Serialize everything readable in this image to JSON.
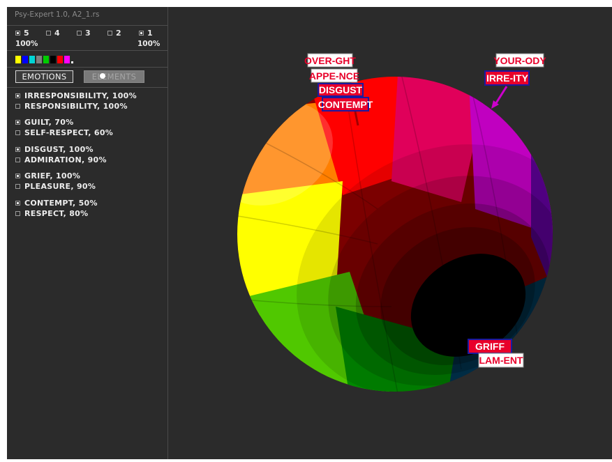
{
  "window": {
    "title": "Psy-Expert 1.0, A2_1.rs"
  },
  "levels": [
    {
      "label": "5",
      "checked": true
    },
    {
      "label": "4",
      "checked": false
    },
    {
      "label": "3",
      "checked": false
    },
    {
      "label": "2",
      "checked": false
    },
    {
      "label": "1",
      "checked": true
    }
  ],
  "percent_left": "100%",
  "percent_right": "100%",
  "palette": [
    "#ffff00",
    "#0000ff",
    "#00d4d4",
    "#808080",
    "#00cc00",
    "#000000",
    "#ff0000",
    "#ff00ff",
    "#ffffff"
  ],
  "tabs": {
    "emotions": "EMOTIONS",
    "elements": "ELEMENTS"
  },
  "emotion_pairs": [
    {
      "top": "IRRESPONSIBILITY, 100%",
      "bottom": "RESPONSIBILITY, 100%",
      "top_checked": true,
      "bottom_checked": false
    },
    {
      "top": "GUILT, 70%",
      "bottom": "SELF-RESPECT, 60%",
      "top_checked": true,
      "bottom_checked": false
    },
    {
      "top": "DISGUST, 100%",
      "bottom": "ADMIRATION, 90%",
      "top_checked": true,
      "bottom_checked": false
    },
    {
      "top": "GRIEF, 100%",
      "bottom": "PLEASURE, 90%",
      "top_checked": true,
      "bottom_checked": false
    },
    {
      "top": "CONTEMPT, 50%",
      "bottom": "RESPECT, 80%",
      "top_checked": true,
      "bottom_checked": false
    }
  ],
  "sphere_labels": {
    "over_ght": "OVER-GHT",
    "appe_nce": "APPE-NCE",
    "disgust": "DISGUST",
    "contempt": "CONTEMPT",
    "your_ody": "YOUR-ODY",
    "irre_ity": "IRRE-ITY",
    "griff": "GRIFF",
    "lam_ent": "LAM-ENT"
  },
  "colors": {
    "panel_bg": "#2b2b2b",
    "label_red": "#e8002a",
    "label_border": "#1a1aa0",
    "arrow_magenta": "#cc00cc"
  }
}
